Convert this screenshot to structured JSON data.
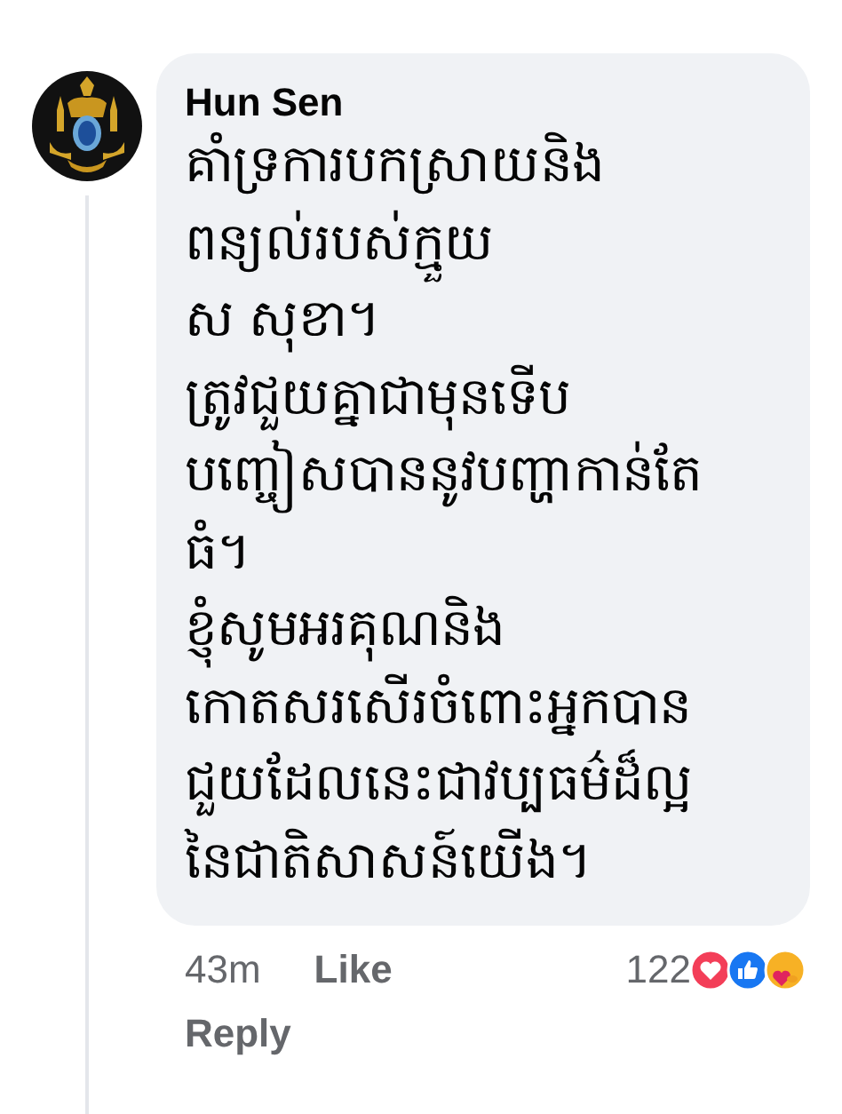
{
  "comment": {
    "author": "Hun Sen",
    "lines": [
      "គាំទ្រការបកស្រាយនិង",
      "ពន្យល់របស់ក្មួយ",
      "ស សុខា។",
      "ត្រូវជួយគ្នាជាមុនទើប",
      "បញ្ចៀសបាននូវបញ្ហាកាន់តែ",
      "ធំ។",
      "ខ្ញុំសូមអរគុណនិង",
      "កោតសរសើរចំពោះអ្នកបាន",
      "ជួយដែលនេះជាវប្បធម៌ដ៏ល្អ",
      "នៃជាតិសាសន៍យើង។"
    ],
    "time": "43m",
    "actions": [
      {
        "label": "Like"
      },
      {
        "label": "Reply"
      }
    ],
    "reaction_count": "122",
    "reactions": [
      {
        "kind": "love"
      },
      {
        "kind": "like"
      },
      {
        "kind": "care"
      }
    ]
  }
}
